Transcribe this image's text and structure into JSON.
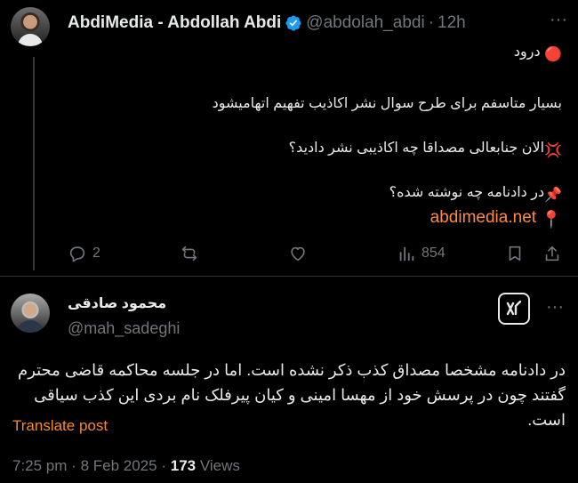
{
  "tweet": {
    "author_name": "AbdiMedia - Abdollah Abdi",
    "handle": "@abdolah_abdi",
    "separator": "·",
    "time": "12h",
    "lines": [
      "درود",
      "بسیار متاسفم برای طرح سوال نشر اکاذیب تفهیم اتهامیشود",
      "الان جنابعالی مصداقا چه اکاذیبی نشر دادید؟",
      "در دادنامه چه نوشته شده؟",
      "abdimedia.net"
    ],
    "line_emojis": [
      "🔴",
      "",
      "💢",
      "📌",
      "📍"
    ],
    "stats": {
      "replies": "2",
      "reposts": "",
      "likes": "",
      "views": "854"
    }
  },
  "reply": {
    "author_name": "محمود صادقی",
    "handle": "@mah_sadeghi",
    "body": "در دادنامه مشخصا مصداق کذب ذکر نشده است. اما در جلسه محاکمه قاضی محترم گفتند چون در پرسش خود از مهسا امینی و کیان پیرفلک نام بردی این کذب سیاقی است.",
    "translate_label": "Translate post",
    "time": "7:25 pm",
    "separator": "·",
    "date": "8 Feb 2025",
    "views_count": "173",
    "views_label": "Views"
  },
  "colors": {
    "background": "#000000",
    "text": "#e7e9ea",
    "muted": "#71767b",
    "link": "#ff8a3d",
    "verified": "#1d9bf0"
  },
  "icons": [
    "more-icon",
    "verified-icon",
    "reply-icon",
    "repost-icon",
    "like-icon",
    "views-icon",
    "bookmark-icon",
    "share-icon",
    "grok-icon"
  ]
}
